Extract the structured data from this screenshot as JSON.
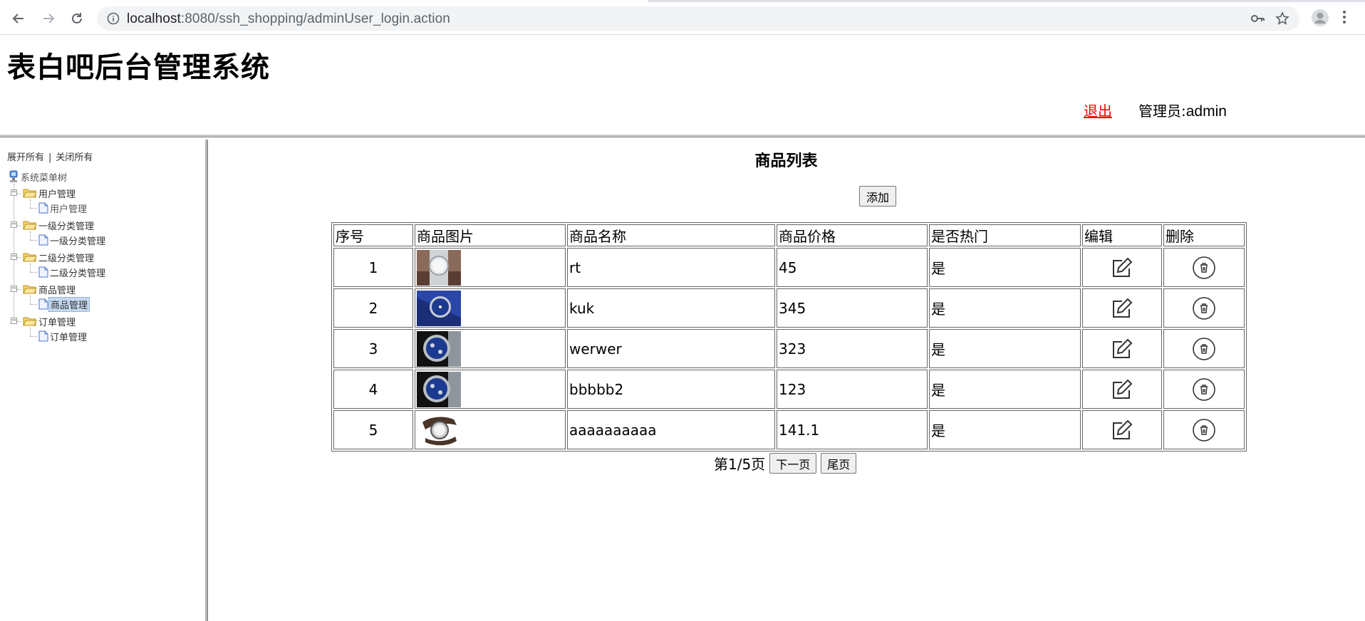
{
  "browser": {
    "url_host": "localhost",
    "url_path": ":8080/ssh_shopping/adminUser_login.action"
  },
  "header": {
    "site_title": "表白吧后台管理系统",
    "logout_label": "退出",
    "admin_prefix": "管理员:",
    "admin_name": "admin"
  },
  "tree": {
    "expand_all": "展开所有",
    "separator": "|",
    "collapse_all": "关闭所有",
    "root_label": "系统菜单树",
    "folders": [
      {
        "label": "用户管理",
        "child": "用户管理"
      },
      {
        "label": "一级分类管理",
        "child": "一级分类管理"
      },
      {
        "label": "二级分类管理",
        "child": "二级分类管理"
      },
      {
        "label": "商品管理",
        "child": "商品管理"
      },
      {
        "label": "订单管理",
        "child": "订单管理"
      }
    ],
    "selected": "商品管理"
  },
  "main": {
    "list_title": "商品列表",
    "add_label": "添加",
    "columns": [
      "序号",
      "商品图片",
      "商品名称",
      "商品价格",
      "是否热门",
      "编辑",
      "删除"
    ],
    "rows": [
      {
        "no": "1",
        "name": "rt",
        "price": "45",
        "hot": "是",
        "thumb": "watch-silver"
      },
      {
        "no": "2",
        "name": "kuk",
        "price": "345",
        "hot": "是",
        "thumb": "watch-blue"
      },
      {
        "no": "3",
        "name": "werwer",
        "price": "323",
        "hot": "是",
        "thumb": "watch-black"
      },
      {
        "no": "4",
        "name": "bbbbb2",
        "price": "123",
        "hot": "是",
        "thumb": "watch-black"
      },
      {
        "no": "5",
        "name": "aaaaaaaaaa",
        "price": "141.1",
        "hot": "是",
        "thumb": "watch-leather"
      }
    ],
    "pager": {
      "page_text": "第1/5页",
      "next_label": "下一页",
      "last_label": "尾页"
    }
  },
  "colors": {
    "logout": "#ff0000",
    "selected_bg": "#c6d9f1",
    "folder": "#f5d66b",
    "watch_blue": "#1c3a8f"
  }
}
